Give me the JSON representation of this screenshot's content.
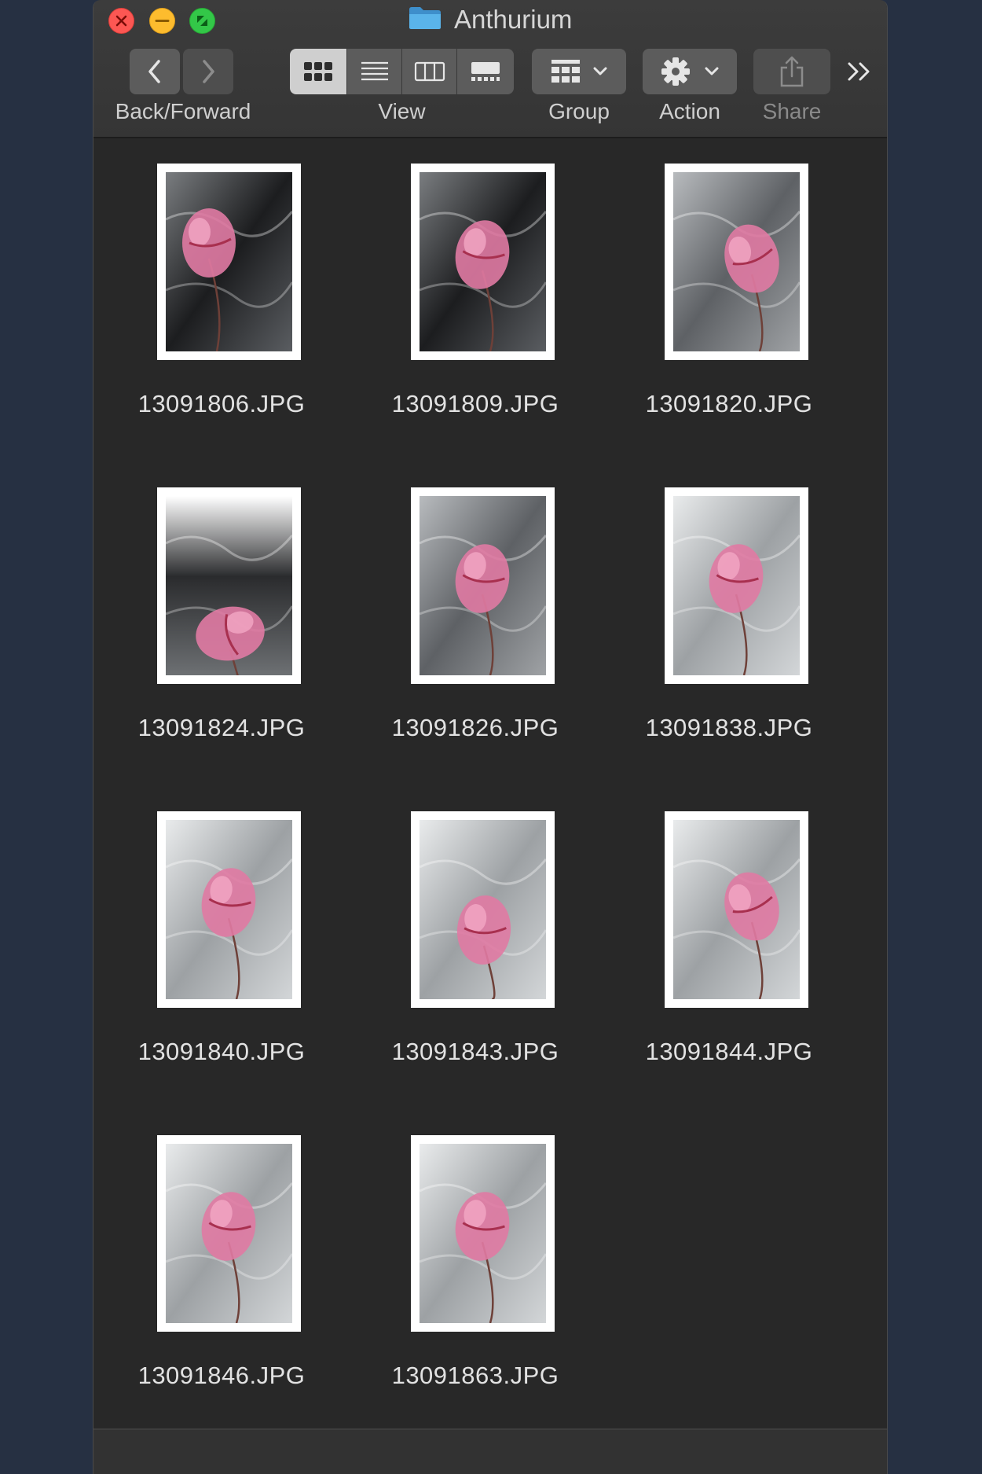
{
  "window": {
    "title": "Anthurium"
  },
  "toolbar": {
    "back_forward_label": "Back/Forward",
    "view_label": "View",
    "group_label": "Group",
    "action_label": "Action",
    "share_label": "Share",
    "overflow_glyph": "»",
    "view_modes": [
      "icons",
      "list",
      "columns",
      "gallery"
    ],
    "active_view": "icons"
  },
  "files": [
    {
      "name": "13091806.JPG",
      "bg": "dark",
      "flower": "left"
    },
    {
      "name": "13091809.JPG",
      "bg": "dark",
      "flower": "center"
    },
    {
      "name": "13091820.JPG",
      "bg": "grey",
      "flower": "right"
    },
    {
      "name": "13091824.JPG",
      "bg": "fade",
      "flower": "bottom"
    },
    {
      "name": "13091826.JPG",
      "bg": "grey",
      "flower": "center"
    },
    {
      "name": "13091838.JPG",
      "bg": "light",
      "flower": "center"
    },
    {
      "name": "13091840.JPG",
      "bg": "light",
      "flower": "center"
    },
    {
      "name": "13091843.JPG",
      "bg": "light",
      "flower": "center-low"
    },
    {
      "name": "13091844.JPG",
      "bg": "light",
      "flower": "right"
    },
    {
      "name": "13091846.JPG",
      "bg": "light",
      "flower": "center"
    },
    {
      "name": "13091863.JPG",
      "bg": "light",
      "flower": "center"
    }
  ],
  "colors": {
    "desktop": "#263042",
    "window_bg": "#2a2a2a",
    "close": "#fc5753",
    "minimize": "#fdbc2e",
    "maximize": "#33c748",
    "flower_pink": "#e07aa3",
    "folder_blue": "#4fa8e0"
  }
}
